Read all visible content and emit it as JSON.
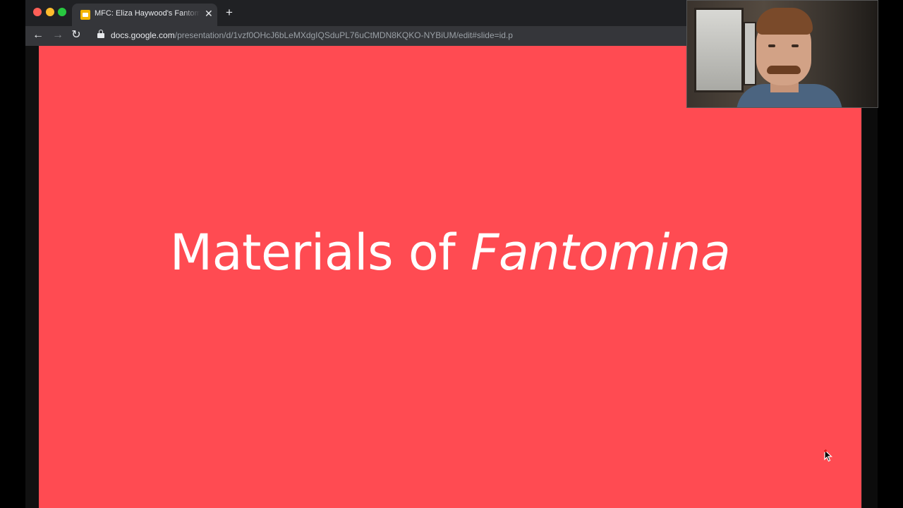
{
  "browser": {
    "tab": {
      "title": "MFC: Eliza Haywood's Fantomina",
      "close_glyph": "✕",
      "favicon": "google-slides-icon"
    },
    "new_tab_glyph": "+",
    "nav": {
      "back_glyph": "←",
      "forward_glyph": "→",
      "reload_glyph": "↻"
    },
    "address_bar": {
      "host": "docs.google.com",
      "path": "/presentation/d/1vzf0OHcJ6bLeMXdgIQSduPL76uCtMDN8KQKO-NYBiUM/edit#slide=id.p"
    }
  },
  "slide": {
    "title_plain": "Materials of ",
    "title_italic": "Fantomina",
    "background_color": "#ff4b52"
  }
}
